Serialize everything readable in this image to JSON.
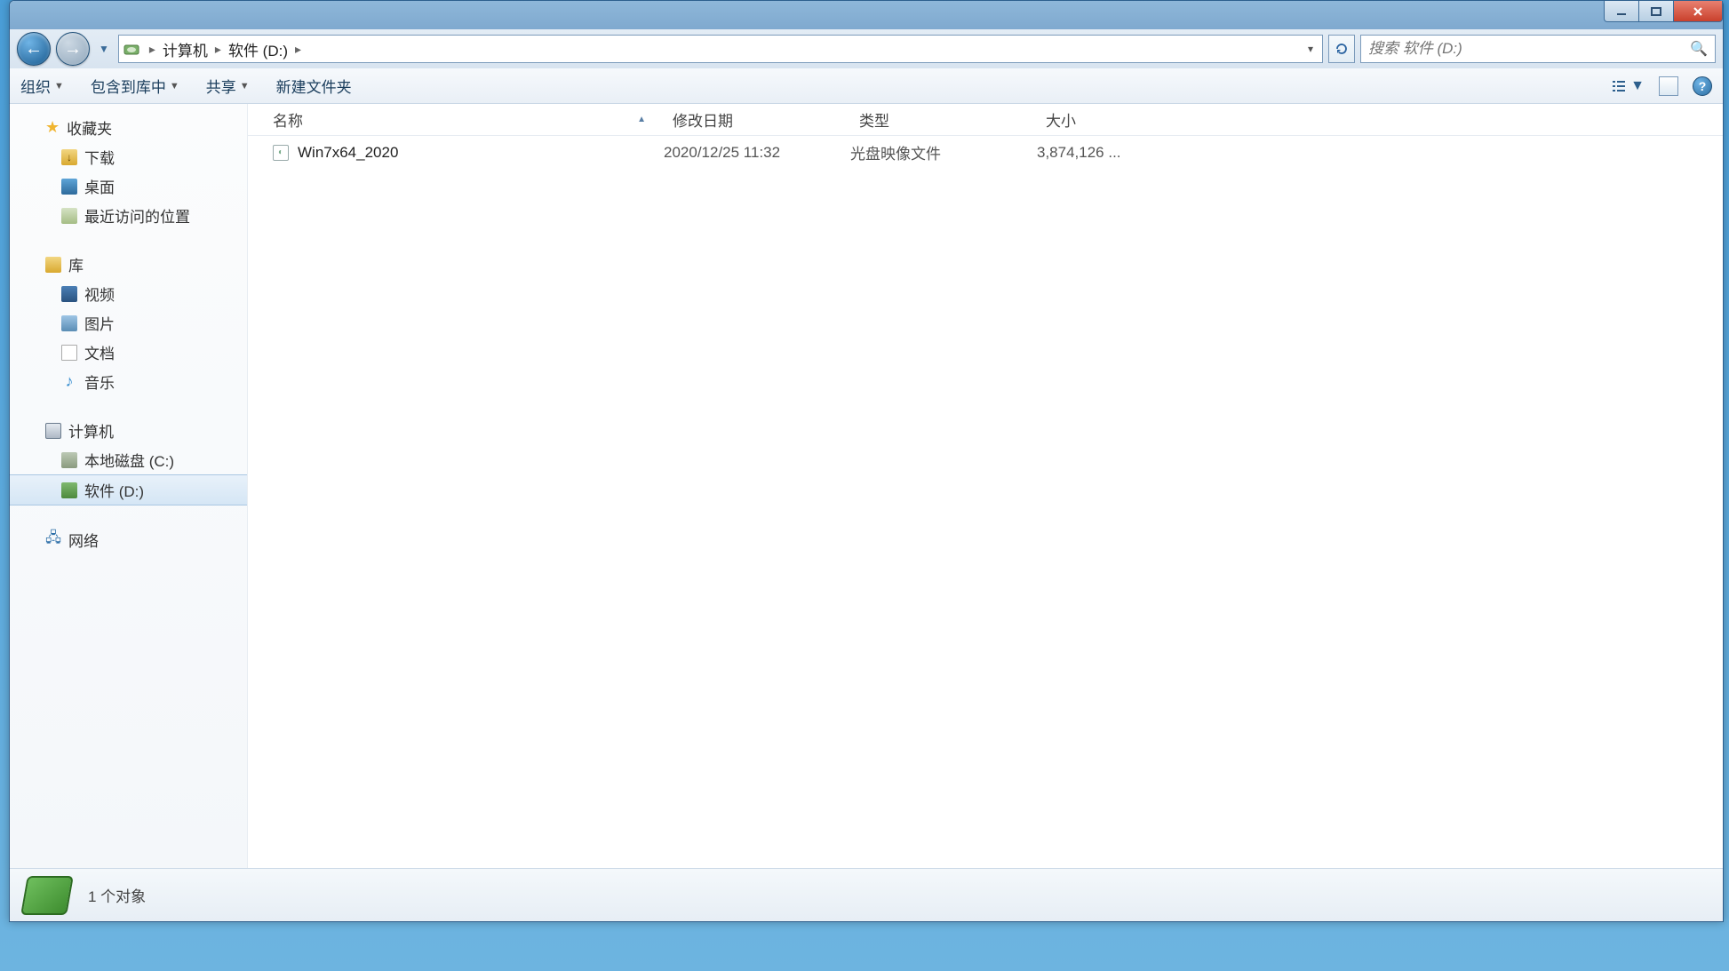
{
  "breadcrumb": {
    "computer": "计算机",
    "drive": "软件 (D:)"
  },
  "search": {
    "placeholder": "搜索 软件 (D:)"
  },
  "toolbar": {
    "organize": "组织",
    "include": "包含到库中",
    "share": "共享",
    "newfolder": "新建文件夹"
  },
  "columns": {
    "name": "名称",
    "date": "修改日期",
    "type": "类型",
    "size": "大小"
  },
  "sidebar": {
    "favorites": "收藏夹",
    "downloads": "下载",
    "desktop": "桌面",
    "recent": "最近访问的位置",
    "libraries": "库",
    "video": "视频",
    "pictures": "图片",
    "documents": "文档",
    "music": "音乐",
    "computer": "计算机",
    "drive_c": "本地磁盘 (C:)",
    "drive_d": "软件 (D:)",
    "network": "网络"
  },
  "file": {
    "name": "Win7x64_2020",
    "date": "2020/12/25 11:32",
    "type": "光盘映像文件",
    "size": "3,874,126 ..."
  },
  "status": {
    "count": "1 个对象"
  },
  "helpchar": "?"
}
